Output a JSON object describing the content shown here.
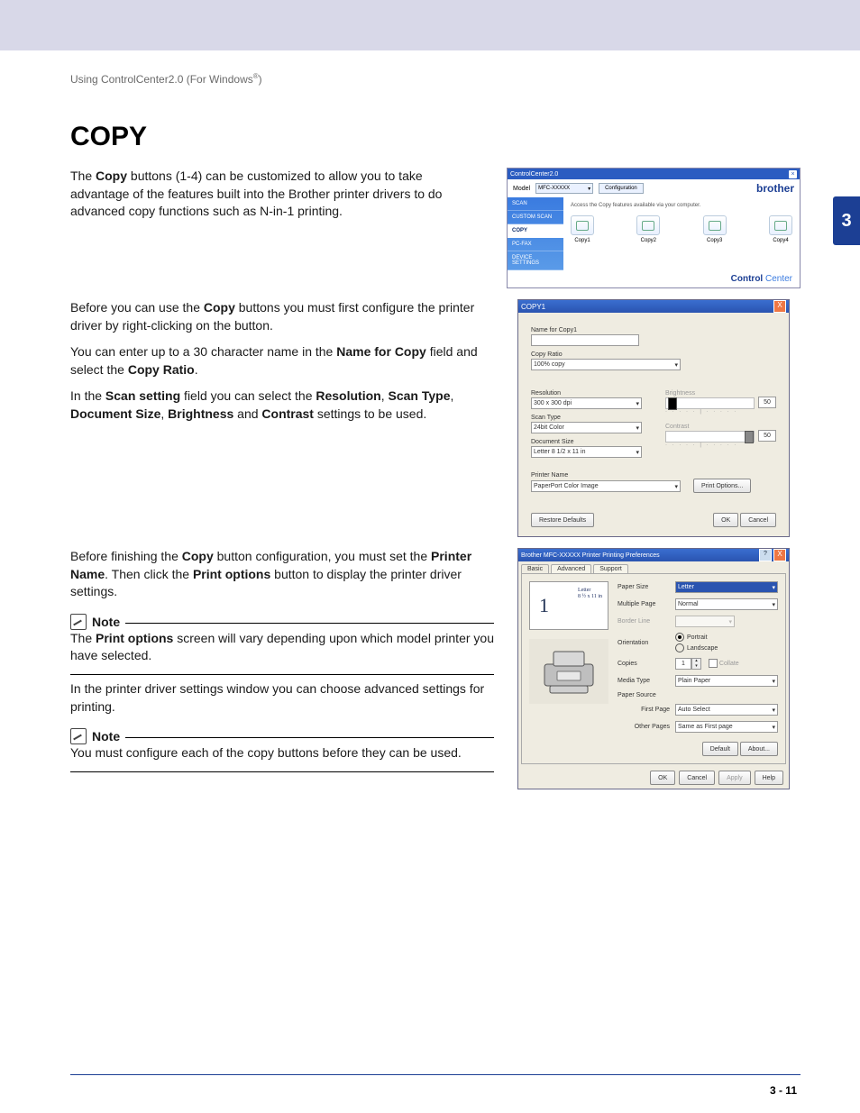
{
  "running_head": {
    "text": "Using ControlCenter2.0 (For Windows",
    "suffix": ")"
  },
  "h1": "COPY",
  "para1": "The <b>Copy</b> buttons (1-4) can be customized to allow you to take advantage of the features built into the Brother printer drivers to do advanced copy functions such as N-in-1 printing.",
  "para2": "Before you can use the <b>Copy</b> buttons you must first configure the printer driver by right-clicking on the button.",
  "para3": "You can enter up to a 30 character name in the <b>Name for Copy</b> field and select the <b>Copy Ratio</b>.",
  "para4": "In the <b>Scan setting</b> field you can select the <b>Resolution</b>, <b>Scan Type</b>, <b>Document Size</b>, <b>Brightness</b> and <b>Contrast</b> settings to be used.",
  "para5": "Before finishing the <b>Copy</b> button configuration, you must set the <b>Printer Name</b>. Then click the <b>Print options</b> button to display the printer driver settings.",
  "note_label": "Note",
  "note1": "The <b>Print options</b> screen will vary depending upon which model printer you have selected.",
  "para6": "In the printer driver settings window you can choose advanced settings for printing.",
  "note2": "You must configure each of the copy buttons before they can be used.",
  "tab": "3",
  "footer": "3 - 11",
  "cc": {
    "title": "ControlCenter2.0",
    "model_label": "Model",
    "model_value": "MFC-XXXXX",
    "config": "Configuration",
    "brand": "brother",
    "side": [
      "SCAN",
      "CUSTOM SCAN",
      "COPY",
      "PC-FAX",
      "DEVICE SETTINGS"
    ],
    "side_selected_index": 2,
    "hint": "Access the Copy features available via your computer.",
    "buttons": [
      "Copy1",
      "Copy2",
      "Copy3",
      "Copy4"
    ],
    "footer_bold": "Control",
    "footer_light": " Center"
  },
  "copy1": {
    "title": "COPY1",
    "name_label": "Name for Copy1",
    "name_value": "",
    "ratio_label": "Copy Ratio",
    "ratio_value": "100% copy",
    "res_label": "Resolution",
    "res_value": "300 x 300 dpi",
    "type_label": "Scan Type",
    "type_value": "24bit Color",
    "size_label": "Document Size",
    "size_value": "Letter 8 1/2 x 11 in",
    "bright_label": "Brightness",
    "bright_value": "50",
    "contrast_label": "Contrast",
    "contrast_value": "50",
    "printer_label": "Printer Name",
    "printer_value": "PaperPort Color Image",
    "print_options": "Print Options...",
    "restore": "Restore Defaults",
    "ok": "OK",
    "cancel": "Cancel"
  },
  "pp": {
    "title": "Brother MFC-XXXXX Printer Printing Preferences",
    "tabs": [
      "Basic",
      "Advanced",
      "Support"
    ],
    "selected_tab": 0,
    "thumb_number": "1",
    "thumb_meta1": "Letter",
    "thumb_meta2": "8 ½ x 11 in",
    "rows": {
      "paper_size": {
        "k": "Paper Size",
        "v": "Letter"
      },
      "multiple_page": {
        "k": "Multiple Page",
        "v": "Normal"
      },
      "border_line": {
        "k": "Border Line",
        "v": ""
      },
      "orientation": {
        "k": "Orientation",
        "portrait": "Portrait",
        "landscape": "Landscape"
      },
      "copies": {
        "k": "Copies",
        "n": "1",
        "collate": "Collate"
      },
      "media_type": {
        "k": "Media Type",
        "v": "Plain Paper"
      },
      "paper_source": {
        "k": "Paper Source"
      },
      "first_page": {
        "k": "First Page",
        "v": "Auto Select"
      },
      "other_pages": {
        "k": "Other Pages",
        "v": "Same as First page"
      }
    },
    "default_btn": "Default",
    "about_btn": "About...",
    "ok": "OK",
    "cancel": "Cancel",
    "apply": "Apply",
    "help": "Help"
  }
}
